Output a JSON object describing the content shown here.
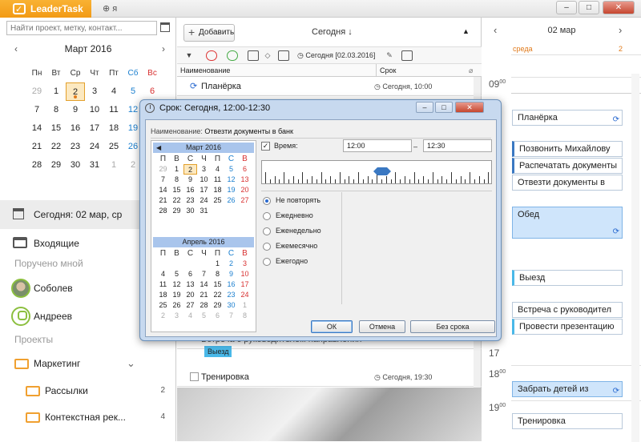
{
  "app": {
    "brand": "LeaderTask",
    "sync_label": "я",
    "window_buttons": {
      "minimize": "‒",
      "maximize": "□",
      "close": "✕"
    }
  },
  "left": {
    "search_placeholder": "Найти проект, метку, контакт...",
    "calendar": {
      "month_title": "Март 2016",
      "prev": "‹",
      "next": "›",
      "weekdays": [
        "Пн",
        "Вт",
        "Ср",
        "Чт",
        "Пт",
        "Сб",
        "Вс"
      ],
      "weeks": [
        [
          "29",
          "1",
          "2",
          "3",
          "4",
          "5",
          "6"
        ],
        [
          "7",
          "8",
          "9",
          "10",
          "11",
          "12",
          "13"
        ],
        [
          "14",
          "15",
          "16",
          "17",
          "18",
          "19",
          "20"
        ],
        [
          "21",
          "22",
          "23",
          "24",
          "25",
          "26",
          "27"
        ],
        [
          "28",
          "29",
          "30",
          "31",
          "1",
          "2",
          "3"
        ]
      ],
      "today_day": "2"
    },
    "today_label": "Сегодня: 02 мар, ср",
    "inbox": "Входящие",
    "assigned_section": "Поручено мной",
    "people": [
      "Соболев",
      "Андреев"
    ],
    "projects_section": "Проекты",
    "projects": [
      {
        "name": "Маркетинг",
        "count": ""
      },
      {
        "name": "Рассылки",
        "count": "2"
      },
      {
        "name": "Контекстная рек...",
        "count": "4"
      }
    ]
  },
  "center": {
    "add_button": "Добавить",
    "title": "Сегодня ↓",
    "toolbar_date": "Сегодня [02.03.2016]",
    "columns": {
      "name": "Наименование",
      "term": "Срок"
    },
    "tasks": [
      {
        "name": "Планёрка",
        "term": "Сегодня, 10:00"
      },
      {
        "name": "Встреча с руководителем направления",
        "term": ""
      },
      {
        "name": "Тренировка",
        "term": "Сегодня, 19:30"
      }
    ],
    "tag": "Выезд"
  },
  "right": {
    "date": "02 мар",
    "weekday": "среда",
    "weekday_num": "2",
    "hours": [
      {
        "h": "09",
        "m": "00"
      },
      {
        "h": "17",
        "m": ""
      },
      {
        "h": "18",
        "m": "00"
      },
      {
        "h": "19",
        "m": "00"
      }
    ],
    "events": [
      "Планёрка",
      "Позвонить Михайлову",
      "Распечатать документы",
      "Отвезти документы в",
      "Обед",
      "Выезд",
      "Встреча с руководител",
      "Провести презентацию",
      "Забрать детей из",
      "Тренировка"
    ]
  },
  "dialog": {
    "title": "Срок: Сегодня, 12:00-12:30",
    "name_label": "Наименование:",
    "name_value": "Отвезти документы в банк",
    "cal1": {
      "title": "Март 2016",
      "weekdays": [
        "П",
        "В",
        "С",
        "Ч",
        "П",
        "С",
        "В"
      ],
      "days": [
        "29",
        "1",
        "2",
        "3",
        "4",
        "5",
        "6",
        "7",
        "8",
        "9",
        "10",
        "11",
        "12",
        "13",
        "14",
        "15",
        "16",
        "17",
        "18",
        "19",
        "20",
        "21",
        "22",
        "23",
        "24",
        "25",
        "26",
        "27",
        "28",
        "29",
        "30",
        "31",
        "",
        "",
        ""
      ]
    },
    "cal2": {
      "title": "Апрель 2016",
      "weekdays": [
        "П",
        "В",
        "С",
        "Ч",
        "П",
        "С",
        "В"
      ],
      "days": [
        "",
        "",
        "",
        "",
        "1",
        "2",
        "3",
        "4",
        "5",
        "6",
        "7",
        "8",
        "9",
        "10",
        "11",
        "12",
        "13",
        "14",
        "15",
        "16",
        "17",
        "18",
        "19",
        "20",
        "21",
        "22",
        "23",
        "24",
        "25",
        "26",
        "27",
        "28",
        "29",
        "30",
        "1",
        "2",
        "3",
        "4",
        "5",
        "6",
        "7",
        "8"
      ]
    },
    "time_label": "Время:",
    "time_from": "12:00",
    "time_to": "12:30",
    "repeat_options": [
      "Не повторять",
      "Ежедневно",
      "Еженедельно",
      "Ежемесячно",
      "Ежегодно"
    ],
    "selected_repeat": 0,
    "buttons": {
      "ok": "ОК",
      "cancel": "Отмена",
      "no_term": "Без срока"
    }
  },
  "colors": {
    "brand": "#f29a15",
    "today_highlight": "#fce9c1",
    "weekend_blue": "#1a7fcf",
    "weekend_red": "#d83030",
    "event_blue": "#3a78c2"
  }
}
